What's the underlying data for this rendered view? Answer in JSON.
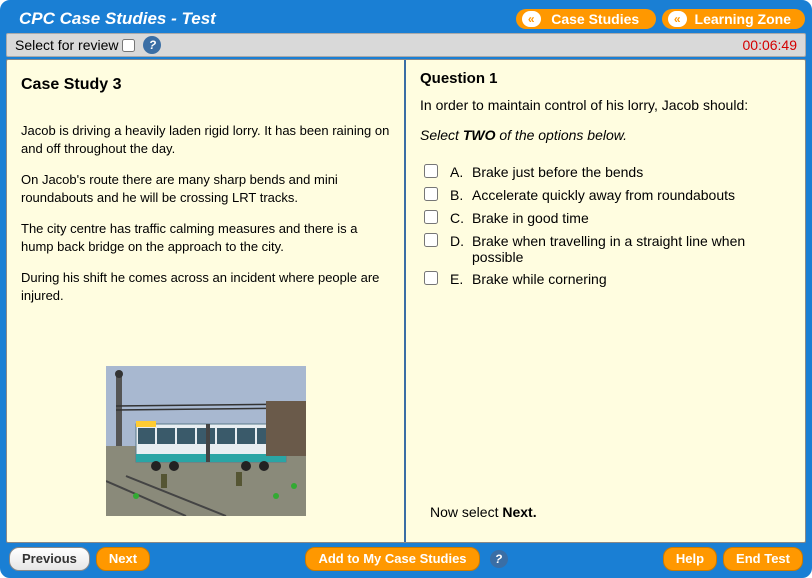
{
  "header": {
    "title": "CPC Case Studies - Test",
    "nav": [
      {
        "label": "Case Studies"
      },
      {
        "label": "Learning Zone"
      }
    ]
  },
  "subbar": {
    "review_label": "Select for review",
    "timer": "00:06:49"
  },
  "case": {
    "title": "Case Study 3",
    "paragraphs": [
      "Jacob is driving a heavily laden rigid lorry. It has been raining on and off throughout the day.",
      "On Jacob's route there are many sharp bends and mini roundabouts and he will be crossing LRT tracks.",
      "The city centre has traffic calming measures and there is a hump back bridge on the approach to the city.",
      "During his shift he comes across an incident where people are injured."
    ]
  },
  "question": {
    "title": "Question 1",
    "stem": "In order to maintain control of his lorry, Jacob should:",
    "instruction_prefix": "Select ",
    "instruction_bold": "TWO",
    "instruction_suffix": " of the options below.",
    "options": [
      {
        "letter": "A.",
        "text": "Brake just before the bends"
      },
      {
        "letter": "B.",
        "text": "Accelerate quickly away from roundabouts"
      },
      {
        "letter": "C.",
        "text": "Brake in good time"
      },
      {
        "letter": "D.",
        "text": "Brake when travelling in a straight line when possible"
      },
      {
        "letter": "E.",
        "text": "Brake while cornering"
      }
    ],
    "now_prefix": "Now select ",
    "now_bold": "Next."
  },
  "footer": {
    "previous": "Previous",
    "next": "Next",
    "add": "Add to My Case Studies",
    "help": "Help",
    "end": "End Test"
  }
}
